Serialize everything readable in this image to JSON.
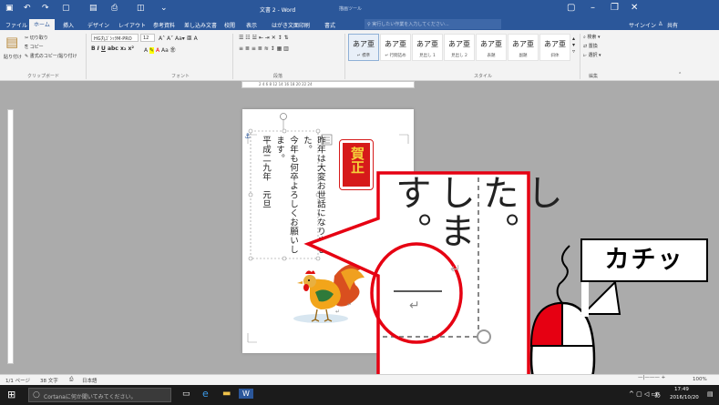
{
  "window": {
    "title": "文書 2 - Word",
    "context_tool": "描画ツール",
    "controls": [
      "▢",
      "–",
      "❐",
      "✕"
    ]
  },
  "menu": {
    "tabs": [
      "ファイル",
      "ホーム",
      "挿入",
      "デザイン",
      "レイアウト",
      "参考資料",
      "差し込み文書",
      "校閲",
      "表示",
      "はがき文面印刷",
      "書式"
    ],
    "active_tab": "ホーム",
    "tell_me": "♀ 実行したい作業を入力してください...",
    "signin": "サインイン",
    "share": "共有"
  },
  "ribbon": {
    "clipboard": {
      "paste": "貼り付け",
      "cut": "切り取り",
      "copy": "コピー",
      "format_painter": "書式のコピー/貼り付け",
      "label": "クリップボード"
    },
    "font": {
      "name": "HG丸ｺﾞｼｯｸM-PRO",
      "size": "12",
      "label": "フォント"
    },
    "paragraph": {
      "label": "段落"
    },
    "styles": {
      "label": "スタイル",
      "items": [
        {
          "sample": "あア亜",
          "name": "↵ 標準"
        },
        {
          "sample": "あア亜",
          "name": "↵ 行間詰め"
        },
        {
          "sample": "あア亜",
          "name": "見出し 1"
        },
        {
          "sample": "あア亜",
          "name": "見出し 2"
        },
        {
          "sample": "あア亜",
          "name": "表題"
        },
        {
          "sample": "あア亜",
          "name": "副題"
        },
        {
          "sample": "あア亜",
          "name": "斜体"
        }
      ]
    },
    "editing": {
      "find": "検索",
      "replace": "置換",
      "select": "選択",
      "label": "編集"
    }
  },
  "ruler": {
    "ticks": "2   4   6   8        12  14  16  18  20  22  24"
  },
  "document": {
    "body_lines": [
      "昨年は大変お世話になりました。",
      "今年も何卒よろしくお願いします。",
      "平成二九年　元旦"
    ],
    "stamp_text": "賀正",
    "callout_lines": [
      "した。",
      "します。"
    ]
  },
  "annotation": {
    "label": "カチッ",
    "accent": "#e60012"
  },
  "status": {
    "page": "1/1 ページ",
    "words": "38 文字",
    "language": "日本語",
    "zoom": "100%"
  },
  "taskbar": {
    "cortana": "Cortanaに何か聞いてみてください。",
    "time": "17:49",
    "date": "2016/10/20",
    "ime": "あ"
  }
}
